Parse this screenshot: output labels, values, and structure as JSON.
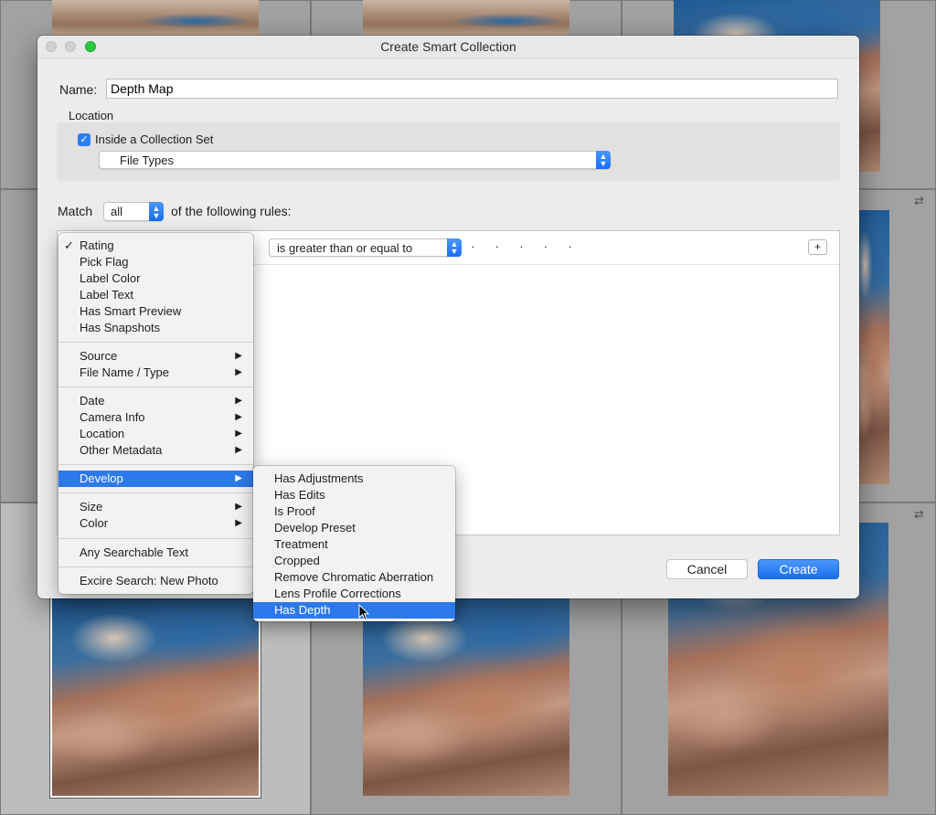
{
  "dialog": {
    "title": "Create Smart Collection",
    "name_label": "Name:",
    "name_value": "Depth Map",
    "location_label": "Location",
    "inside_set_label": "Inside a Collection Set",
    "inside_set_checked": true,
    "collection_set": "File Types",
    "match_label": "Match",
    "match_value": "all",
    "match_suffix": "of the following rules:",
    "rule_operator": "is greater than or equal to",
    "rule_rating": "· · · · ·",
    "add_rule": "+",
    "cancel": "Cancel",
    "create": "Create"
  },
  "criteria_menu": {
    "selected": "Rating",
    "groups": [
      [
        "Rating",
        "Pick Flag",
        "Label Color",
        "Label Text",
        "Has Smart Preview",
        "Has Snapshots"
      ],
      [
        "Source",
        "File Name / Type"
      ],
      [
        "Date",
        "Camera Info",
        "Location",
        "Other Metadata"
      ],
      [
        "Develop"
      ],
      [
        "Size",
        "Color"
      ],
      [
        "Any Searchable Text"
      ],
      [
        "Excire Search: New Photo"
      ]
    ],
    "with_submenu": [
      "Source",
      "File Name / Type",
      "Date",
      "Camera Info",
      "Location",
      "Other Metadata",
      "Develop",
      "Size",
      "Color"
    ],
    "highlighted": "Develop"
  },
  "develop_submenu": {
    "items": [
      "Has Adjustments",
      "Has Edits",
      "Is Proof",
      "Develop Preset",
      "Treatment",
      "Cropped",
      "Remove Chromatic Aberration",
      "Lens Profile Corrections",
      "Has Depth"
    ],
    "highlighted": "Has Depth"
  },
  "colors": {
    "accent": "#2d79ec",
    "checkbox": "#2c7cf4",
    "zoom_button": "#2ac840"
  },
  "icons": {
    "checkmark": "✓",
    "submenu_arrow": "▶",
    "swap": "⇄"
  }
}
